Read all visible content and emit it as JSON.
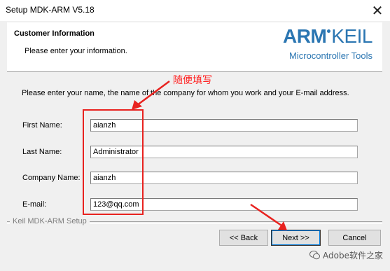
{
  "window": {
    "title": "Setup MDK-ARM V5.18",
    "close_glyph": "✕"
  },
  "header": {
    "title": "Customer Information",
    "subtitle": "Please enter your information.",
    "logo_text_bold": "ARM",
    "logo_text_light": "KEIL",
    "logo_sub": "Microcontroller Tools",
    "brand_color": "#2b76b2"
  },
  "annotation": {
    "text": "随便填写",
    "color": "#e8221f"
  },
  "form": {
    "prompt": "Please enter your name, the name of the company for whom you work and your E-mail address.",
    "fields": [
      {
        "label": "First Name:",
        "value": "aianzh"
      },
      {
        "label": "Last Name:",
        "value": "Administrator"
      },
      {
        "label": "Company Name:",
        "value": "aianzh"
      },
      {
        "label": "E-mail:",
        "value": "123@qq.com"
      }
    ]
  },
  "footer": {
    "group_label": "Keil MDK-ARM Setup",
    "back_label": "<< Back",
    "next_label": "Next >>",
    "cancel_label": "Cancel"
  },
  "watermark": {
    "text": "Adobe软件之家",
    "icon": "wechat-icon"
  }
}
